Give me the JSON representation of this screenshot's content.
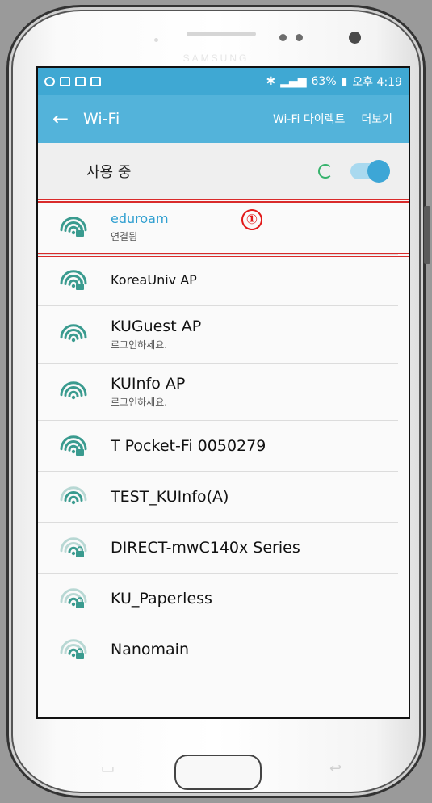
{
  "statusbar": {
    "battery": "63%",
    "time": "오후 4:19"
  },
  "appbar": {
    "back_icon": "←",
    "title": "Wi-Fi",
    "direct": "Wi-Fi 다이렉트",
    "more": "더보기"
  },
  "wifi_toggle": {
    "label": "사용 중",
    "state": "on"
  },
  "annotation": {
    "marker": "①",
    "color": "#d92b2b"
  },
  "networks": [
    {
      "name": "eduroam",
      "sub": "연결됨",
      "locked": true,
      "strength": 3
    },
    {
      "name": "KoreaUniv AP",
      "sub": "",
      "locked": true,
      "strength": 3
    },
    {
      "name": "KUGuest AP",
      "sub": "로그인하세요.",
      "locked": false,
      "strength": 3
    },
    {
      "name": "KUInfo AP",
      "sub": "로그인하세요.",
      "locked": false,
      "strength": 3
    },
    {
      "name": "T Pocket-Fi 0050279",
      "sub": "",
      "locked": true,
      "strength": 3
    },
    {
      "name": "TEST_KUInfo(A)",
      "sub": "",
      "locked": false,
      "strength": 2
    },
    {
      "name": "DIRECT-mwC140x Series",
      "sub": "",
      "locked": true,
      "strength": 1
    },
    {
      "name": "KU_Paperless",
      "sub": "",
      "locked": true,
      "strength": 1
    },
    {
      "name": "Nanomain",
      "sub": "",
      "locked": true,
      "strength": 1
    }
  ],
  "colors": {
    "accent": "#53b3da",
    "statusbar": "#3fa8d3",
    "wifi_icon": "#3a9b8f"
  }
}
